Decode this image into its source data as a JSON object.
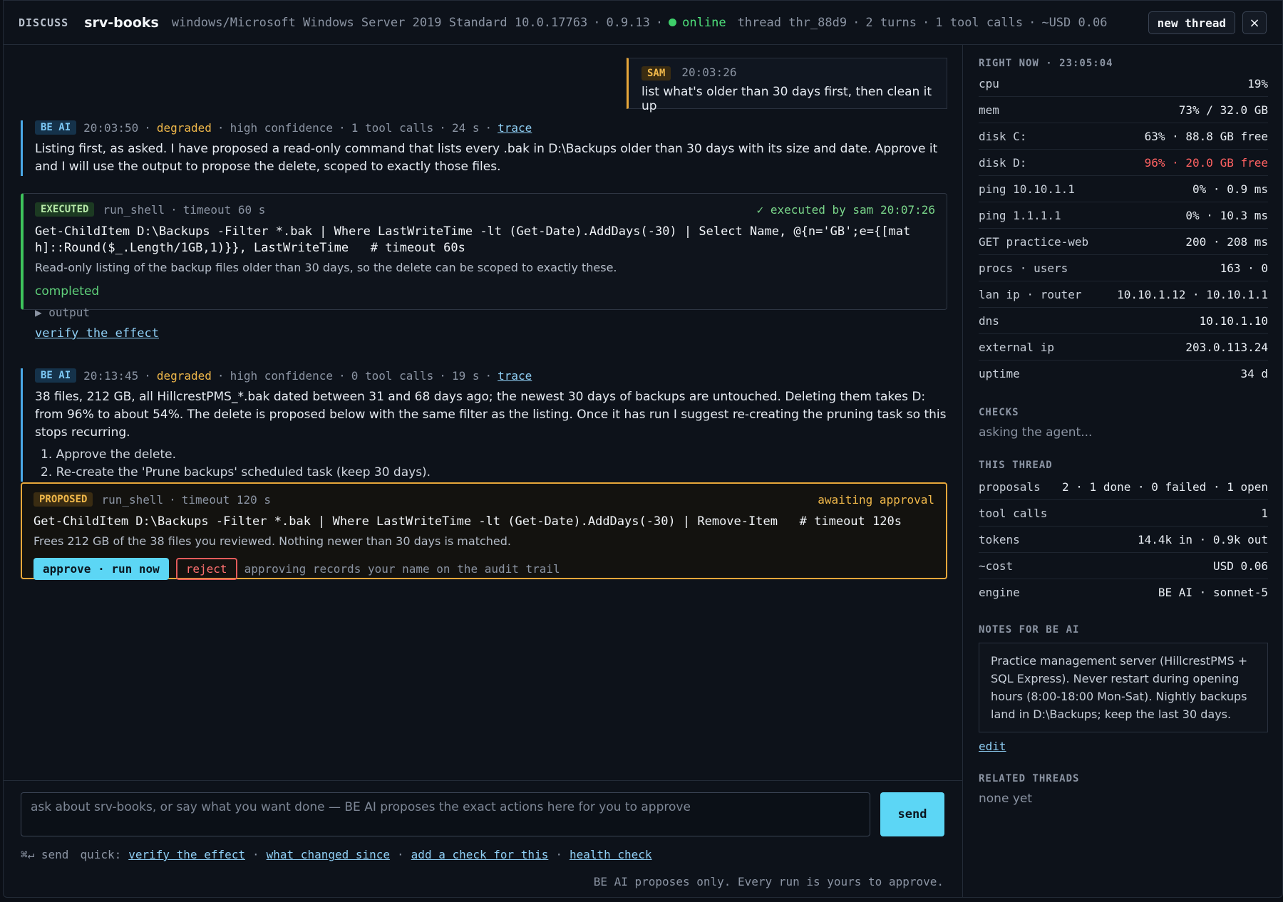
{
  "topbar": {
    "section": "DISCUSS",
    "host": "srv-books",
    "os": "windows/Microsoft Windows Server 2019 Standard 10.0.17763",
    "version": "0.9.13",
    "status": "online",
    "thread": "thread thr_88d9",
    "turns": "2 turns",
    "tool_calls": "1 tool calls",
    "cost": "~USD 0.06",
    "new_thread": "new thread",
    "close": "×"
  },
  "messages": {
    "user": {
      "badge": "SAM",
      "time": "20:03:26",
      "text": "list what's older than 30 days first, then clean it up"
    },
    "ai1": {
      "badge": "BE AI",
      "time": "20:03:50",
      "health": "degraded",
      "confidence": "high confidence",
      "tools": "1 tool calls",
      "duration": "24 s",
      "trace": "trace",
      "text": "Listing first, as asked. I have proposed a read-only command that lists every .bak in D:\\Backups older than 30 days with its size and date. Approve it and I will use the output to propose the delete, scoped to exactly those files."
    },
    "exec": {
      "badge": "EXECUTED",
      "tool": "run_shell",
      "timeout": "timeout 60 s",
      "by": "✓ executed by sam 20:07:26",
      "command": "Get-ChildItem D:\\Backups -Filter *.bak | Where LastWriteTime -lt (Get-Date).AddDays(-30) | Select Name, @{n='GB';e={[math]::Round($_.Length/1GB,1)}}, LastWriteTime   # timeout 60s",
      "desc": "Read-only listing of the backup files older than 30 days, so the delete can be scoped to exactly these.",
      "status": "completed",
      "output": "▶ output",
      "verify": "verify the effect"
    },
    "ai2": {
      "badge": "BE AI",
      "time": "20:13:45",
      "health": "degraded",
      "confidence": "high confidence",
      "tools": "0 tool calls",
      "duration": "19 s",
      "trace": "trace",
      "text": "38 files, 212 GB, all HillcrestPMS_*.bak dated between 31 and 68 days ago; the newest 30 days of backups are untouched. Deleting them takes D: from 96% to about 54%. The delete is proposed below with the same filter as the listing. Once it has run I suggest re-creating the pruning task so this stops recurring.",
      "steps": [
        "1. Approve the delete.",
        "2. Re-create the 'Prune backups' scheduled task (keep 30 days)."
      ]
    },
    "proposed": {
      "badge": "PROPOSED",
      "tool": "run_shell",
      "timeout": "timeout 120 s",
      "state": "awaiting approval",
      "command": "Get-ChildItem D:\\Backups -Filter *.bak | Where LastWriteTime -lt (Get-Date).AddDays(-30) | Remove-Item   # timeout 120s",
      "desc": "Frees 212 GB of the 38 files you reviewed. Nothing newer than 30 days is matched.",
      "approve": "approve · run now",
      "reject": "reject",
      "audit": "approving records your name on the audit trail"
    }
  },
  "composer": {
    "placeholder": "ask about srv-books, or say what you want done — BE AI proposes the exact actions here for you to approve",
    "send": "send",
    "shortcut": "⌘↵ send",
    "quick_label": "quick:",
    "quick": [
      "verify the effect",
      "what changed since",
      "add a check for this",
      "health check"
    ],
    "note": "BE AI proposes only. Every run is yours to approve."
  },
  "side": {
    "right_now": "RIGHT NOW · 23:05:04",
    "metrics": [
      {
        "k": "cpu",
        "v": "19%"
      },
      {
        "k": "mem",
        "v": "73% / 32.0 GB"
      },
      {
        "k": "disk C:",
        "v": "63% · 88.8 GB free"
      },
      {
        "k": "disk D:",
        "v": "96% · 20.0 GB free"
      },
      {
        "k": "ping 10.10.1.1",
        "v": "0% · 0.9 ms"
      },
      {
        "k": "ping 1.1.1.1",
        "v": "0% · 10.3 ms"
      },
      {
        "k": "GET practice-web",
        "v": "200 · 208 ms"
      },
      {
        "k": "procs · users",
        "v": "163 · 0"
      },
      {
        "k": "lan ip · router",
        "v": "10.10.1.12 · 10.10.1.1"
      },
      {
        "k": "dns",
        "v": "10.10.1.10"
      },
      {
        "k": "external ip",
        "v": "203.0.113.24"
      },
      {
        "k": "uptime",
        "v": "34 d"
      }
    ],
    "checks_title": "CHECKS",
    "checks_text": "asking the agent...",
    "thread_title": "THIS THREAD",
    "thread": [
      {
        "k": "proposals",
        "v": "2 · 1 done · 0 failed · 1 open"
      },
      {
        "k": "tool calls",
        "v": "1"
      },
      {
        "k": "tokens",
        "v": "14.4k in · 0.9k out"
      },
      {
        "k": "~cost",
        "v": "USD 0.06"
      },
      {
        "k": "engine",
        "v": "BE AI · sonnet-5"
      }
    ],
    "notes_title": "NOTES FOR BE AI",
    "notes": "Practice management server (HillcrestPMS + SQL Express). Never restart during opening hours (8:00-18:00 Mon-Sat). Nightly backups land in D:\\Backups; keep the last 30 days.",
    "edit": "edit",
    "related_title": "RELATED THREADS",
    "related_text": "none yet"
  }
}
